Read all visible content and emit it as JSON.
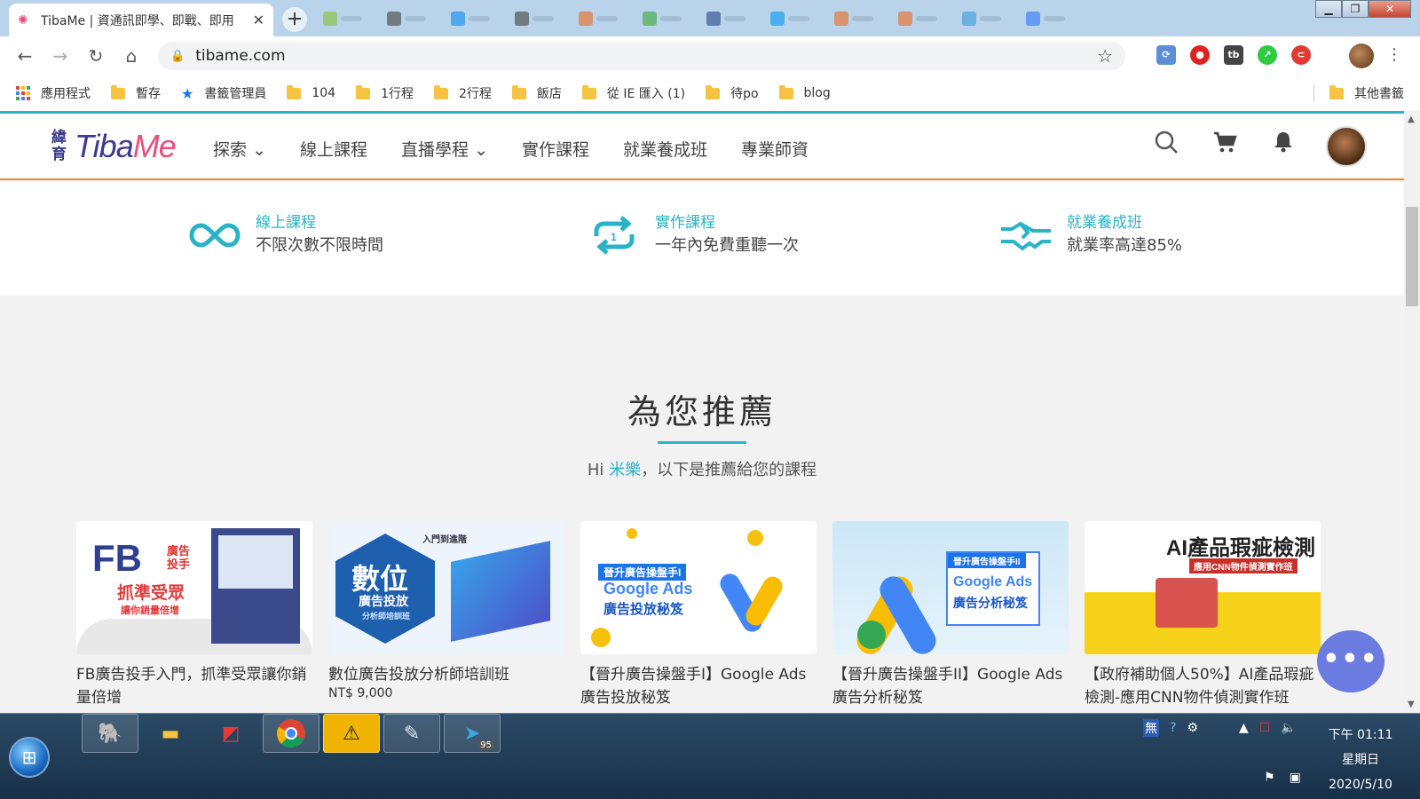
{
  "browser": {
    "tab_title": "TibaMe | 資通訊即學、即戰、即用",
    "tab_close": "✕",
    "new_tab": "+",
    "url": "tibame.com"
  },
  "bookmarks": {
    "items": [
      {
        "label": "應用程式",
        "icon": "apps-icon"
      },
      {
        "label": "暫存",
        "icon": "folder-icon"
      },
      {
        "label": "書籤管理員",
        "icon": "star-icon"
      },
      {
        "label": "104",
        "icon": "folder-icon"
      },
      {
        "label": "1行程",
        "icon": "folder-icon"
      },
      {
        "label": "2行程",
        "icon": "folder-icon"
      },
      {
        "label": "飯店",
        "icon": "folder-icon"
      },
      {
        "label": "從 IE 匯入 (1)",
        "icon": "folder-icon"
      },
      {
        "label": "待po",
        "icon": "folder-icon"
      },
      {
        "label": "blog",
        "icon": "folder-icon"
      }
    ],
    "other": "其他書籤"
  },
  "site": {
    "logo_zh": "緯育",
    "logo_en_a": "Tiba",
    "logo_en_b": "Me",
    "nav": [
      "探索",
      "線上課程",
      "直播學程",
      "實作課程",
      "就業養成班",
      "專業師資"
    ],
    "nav_has_dropdown": [
      true,
      false,
      true,
      false,
      false,
      false
    ]
  },
  "features": [
    {
      "title": "線上課程",
      "desc": "不限次數不限時間",
      "icon": "infinity-icon"
    },
    {
      "title": "實作課程",
      "desc": "一年內免費重聽一次",
      "icon": "repeat-once-icon"
    },
    {
      "title": "就業養成班",
      "desc": "就業率高達85%",
      "icon": "handshake-icon"
    }
  ],
  "recommend": {
    "title": "為您推薦",
    "sub_prefix": "Hi ",
    "user_name": "米樂",
    "sub_suffix": "，以下是推薦給您的課程"
  },
  "courses": [
    {
      "title": "FB廣告投手入門，抓準受眾讓你銷量倍增",
      "price": "",
      "thumb_main": "FB",
      "thumb_sub": "抓準受眾",
      "thumb_note": "讓你銷量倍增",
      "thumb_side": "廣告投手"
    },
    {
      "title": "數位廣告投放分析師培訓班",
      "price": "NT$ 9,000",
      "thumb_main": "數位",
      "thumb_sub": "廣告投放",
      "thumb_note": "分析師培訓班",
      "thumb_side": "入門到進階"
    },
    {
      "title": "【晉升廣告操盤手I】Google Ads 廣告投放秘笈",
      "price": "",
      "thumb_main": "Google Ads",
      "thumb_sub": "廣告投放秘笈",
      "thumb_note": "晉升廣告操盤手I",
      "thumb_side": ""
    },
    {
      "title": "【晉升廣告操盤手II】Google Ads 廣告分析秘笈",
      "price": "",
      "thumb_main": "Google Ads",
      "thumb_sub": "廣告分析秘笈",
      "thumb_note": "晉升廣告操盤手II",
      "thumb_side": ""
    },
    {
      "title": "【政府補助個人50%】AI產品瑕疵檢測-應用CNN物件偵測實作班",
      "price": "",
      "thumb_main": "AI產品瑕疵檢測",
      "thumb_sub": "應用CNN物件偵測實作班",
      "thumb_note": "",
      "thumb_side": ""
    }
  ],
  "chat_fab": "•••",
  "taskbar": {
    "apps": [
      "evernote-icon",
      "explorer-icon",
      "acrobat-icon",
      "chrome-icon",
      "warning-icon",
      "notepad-icon",
      "telegram-icon"
    ],
    "telegram_badge": "95",
    "ime": "無",
    "time": "下午 01:11",
    "weekday": "星期日",
    "date": "2020/5/10"
  },
  "colors": {
    "accent": "#2ab3c7",
    "brand_blue": "#3b3a8f",
    "brand_pink": "#e84f7d",
    "header_border": "#e88a2e",
    "chat": "#6b7be0"
  }
}
